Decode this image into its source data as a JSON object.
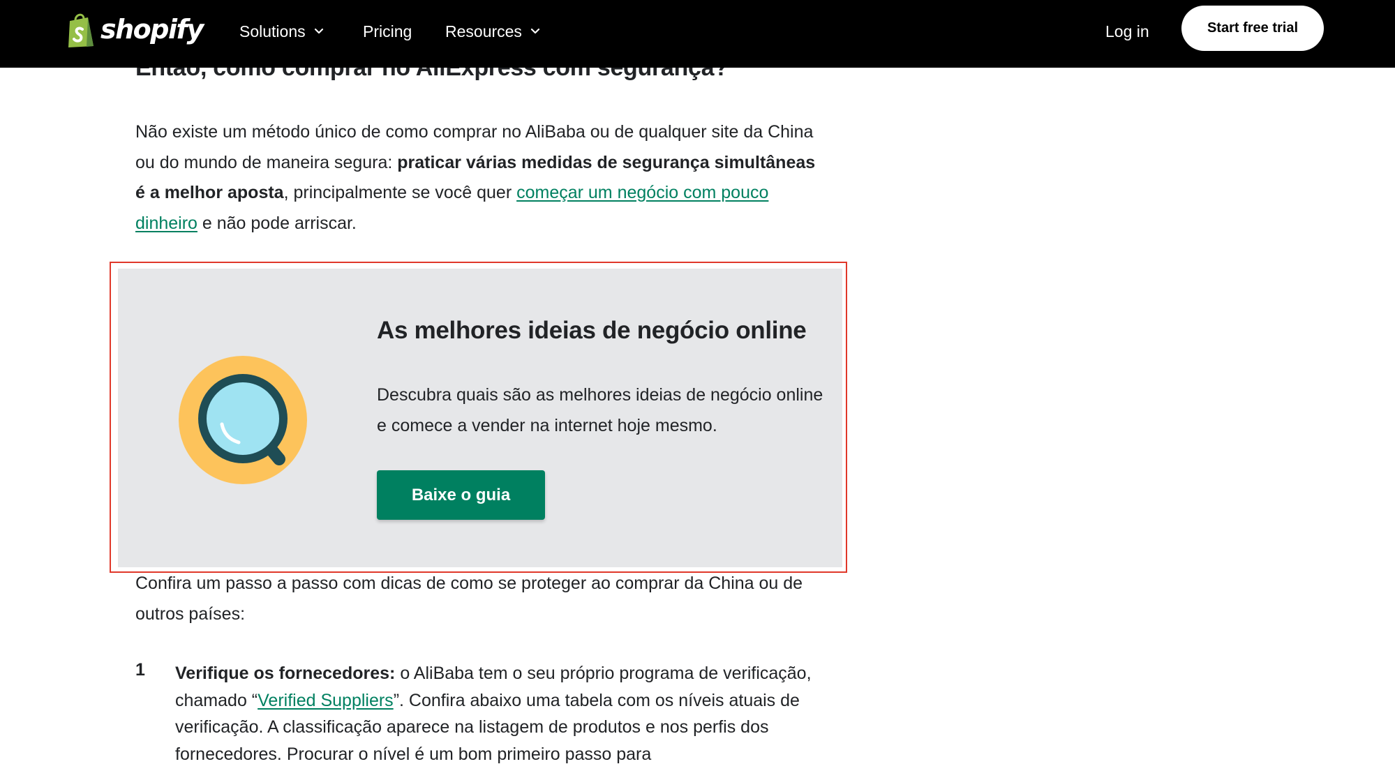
{
  "nav": {
    "logo_text": "shopify",
    "solutions": "Solutions",
    "pricing": "Pricing",
    "resources": "Resources",
    "login": "Log in",
    "trial": "Start free trial"
  },
  "article": {
    "heading": "Então, como comprar no AliExpress com segurança?",
    "p1": {
      "t1": "Não existe um método único de como comprar no AliBaba ou de qualquer site da China ou do mundo de maneira segura: ",
      "bold": "praticar várias medidas de segurança simultâneas é a melhor aposta",
      "t2": ", principalmente se você quer ",
      "link": "começar um negócio com pouco dinheiro",
      "t3": " e não pode arriscar."
    },
    "promo": {
      "icon": "magnifying-glass-icon",
      "title": "As melhores ideias de negócio online",
      "text": "Descubra quais são as melhores ideias de negócio online e comece a vender na internet hoje mesmo.",
      "button": "Baixe o guia"
    },
    "p2": "Confira um passo a passo com dicas de como se proteger ao comprar da China ou de outros países:",
    "list": {
      "num": "1",
      "bold": "Verifique os fornecedores:",
      "t1": " o AliBaba tem o seu próprio programa de verificação, chamado “",
      "link": "Verified Suppliers",
      "t2": "”. Confira abaixo uma tabela com os níveis atuais de verificação. A classificação aparece na listagem de produtos e nos perfis dos fornecedores. Procurar o nível é um bom primeiro passo para"
    }
  },
  "colors": {
    "nav_bg": "#000000",
    "accent_green": "#008060",
    "promo_bg": "#e6e7e9",
    "highlight_outline": "#e0382a",
    "logo_green": "#95bf47"
  }
}
